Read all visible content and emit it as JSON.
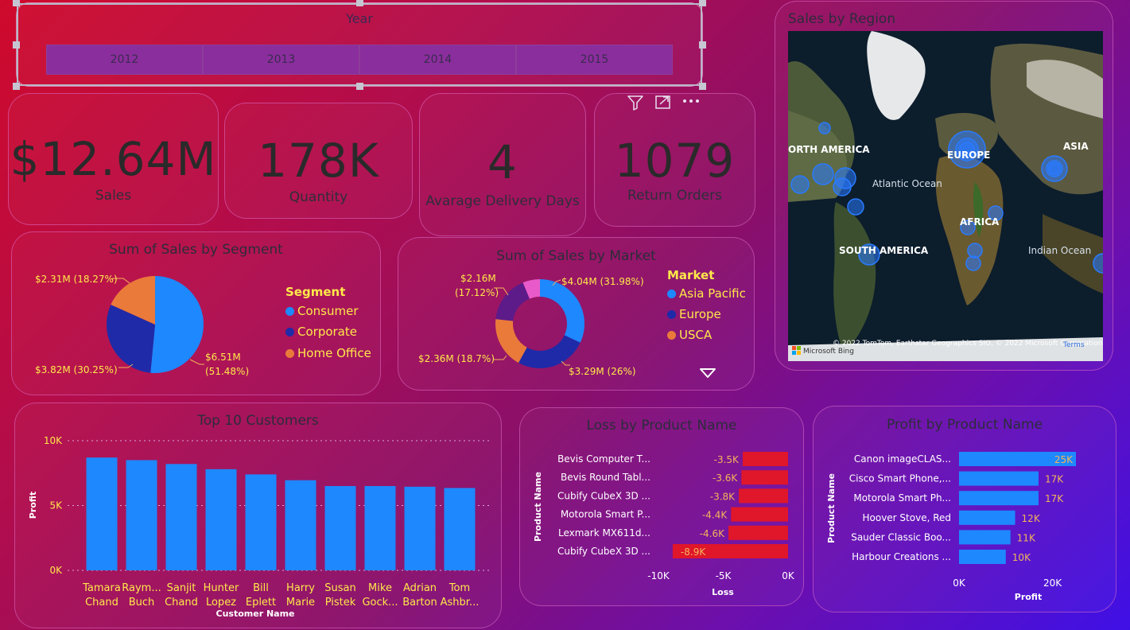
{
  "year_slicer": {
    "title": "Year",
    "years": [
      "2012",
      "2013",
      "2014",
      "2015"
    ]
  },
  "kpis": [
    {
      "value": "$12.64M",
      "label": "Sales"
    },
    {
      "value": "178K",
      "label": "Quantity"
    },
    {
      "value": "4",
      "label": "Avarage Delivery Days"
    },
    {
      "value": "1079",
      "label": "Return Orders"
    }
  ],
  "visual_header_icons": [
    "filter-icon",
    "focus-mode-icon",
    "more-options-icon"
  ],
  "map": {
    "title": "Sales by Region",
    "labels": [
      "ORTH AMERICA",
      "EUROPE",
      "ASIA",
      "Atlantic Ocean",
      "AFRICA",
      "SOUTH AMERICA",
      "Indian Ocean"
    ],
    "attribution": "© 2022 TomTom, Earthstar Geographics SIO, © 2022 Microsoft Corporation, © OpenStreetMap",
    "terms": "Terms",
    "logo": "Microsoft Bing"
  },
  "colors": {
    "bar_blue": "#1e88ff",
    "loss_red": "#e0162a",
    "consumer": "#1e88ff",
    "corporate": "#1f2aa8",
    "home_office": "#ea7a3a",
    "legend_text": "#ffe84a"
  },
  "chart_data": [
    {
      "type": "pie",
      "title": "Sum of Sales by Segment",
      "legend_title": "Segment",
      "categories": [
        "Consumer",
        "Corporate",
        "Home Office"
      ],
      "values": [
        6.51,
        3.82,
        2.31
      ],
      "labels": [
        "$6.51M (51.48%)",
        "$3.82M (30.25%)",
        "$2.31M (18.27%)"
      ],
      "colors": [
        "#1e88ff",
        "#1f2aa8",
        "#ea7a3a"
      ]
    },
    {
      "type": "pie",
      "title": "Sum of Sales by Market",
      "legend_title": "Market",
      "legend_entries": [
        "Asia Pacific",
        "Europe",
        "USCA"
      ],
      "categories": [
        "Asia Pacific",
        "Europe",
        "USCA",
        "",
        ""
      ],
      "values": [
        4.04,
        3.29,
        2.36,
        2.16,
        0.79
      ],
      "labels": [
        "$4.04M (31.98%)",
        "$3.29M (26%)",
        "$2.36M (18.7%)",
        "$2.16M (17.12%)",
        ""
      ],
      "colors": [
        "#1e88ff",
        "#1f2aa8",
        "#ea7a3a",
        "#5d1b8a",
        "#e85ac9"
      ]
    },
    {
      "type": "bar",
      "title": "Top 10 Customers",
      "xlabel": "Customer Name",
      "ylabel": "Profit",
      "categories": [
        "Tamara Chand",
        "Raymond Buch",
        "Sanjit Chand",
        "Hunter Lopez",
        "Bill Eplett",
        "Harry Marie",
        "Susan Pistek",
        "Mike Gockenbach",
        "Adrian Barton",
        "Tom Ashbrook"
      ],
      "category_lines": [
        [
          "Tamara",
          "Chand"
        ],
        [
          "Raym...",
          "Buch"
        ],
        [
          "Sanjit",
          "Chand"
        ],
        [
          "Hunter",
          "Lopez"
        ],
        [
          "Bill",
          "Eplett"
        ],
        [
          "Harry",
          "Marie"
        ],
        [
          "Susan",
          "Pistek"
        ],
        [
          "Mike",
          "Gock..."
        ],
        [
          "Adrian",
          "Barton"
        ],
        [
          "Tom",
          "Ashbr..."
        ]
      ],
      "values": [
        8700,
        8500,
        8200,
        7800,
        7400,
        6950,
        6500,
        6500,
        6450,
        6350
      ],
      "ylim": [
        0,
        10000
      ],
      "yticks": [
        "0K",
        "5K",
        "10K"
      ]
    },
    {
      "type": "bar",
      "orientation": "horizontal",
      "title": "Loss by Product Name",
      "xlabel": "Loss",
      "ylabel": "Product Name",
      "categories": [
        "Bevis Computer T...",
        "Bevis Round Tabl...",
        "Cubify CubeX 3D ...",
        "Motorola Smart P...",
        "Lexmark MX611d...",
        "Cubify CubeX 3D ..."
      ],
      "values": [
        -3500,
        -3600,
        -3800,
        -4400,
        -4600,
        -8900
      ],
      "value_labels": [
        "-3.5K",
        "-3.6K",
        "-3.8K",
        "-4.4K",
        "-4.6K",
        "-8.9K"
      ],
      "xlim": [
        -10000,
        0
      ],
      "xticks": [
        "-10K",
        "-5K",
        "0K"
      ]
    },
    {
      "type": "bar",
      "orientation": "horizontal",
      "title": "Profit by Product Name",
      "xlabel": "Profit",
      "ylabel": "Product Name",
      "categories": [
        "Canon imageCLAS...",
        "Cisco Smart Phone,...",
        "Motorola Smart Ph...",
        "Hoover Stove, Red",
        "Sauder Classic Boo...",
        "Harbour Creations ..."
      ],
      "values": [
        25000,
        17000,
        17000,
        12000,
        11000,
        10000
      ],
      "value_labels": [
        "25K",
        "17K",
        "17K",
        "12K",
        "11K",
        "10K"
      ],
      "xlim": [
        0,
        25000
      ],
      "xticks": [
        "0K",
        "20K"
      ]
    }
  ]
}
